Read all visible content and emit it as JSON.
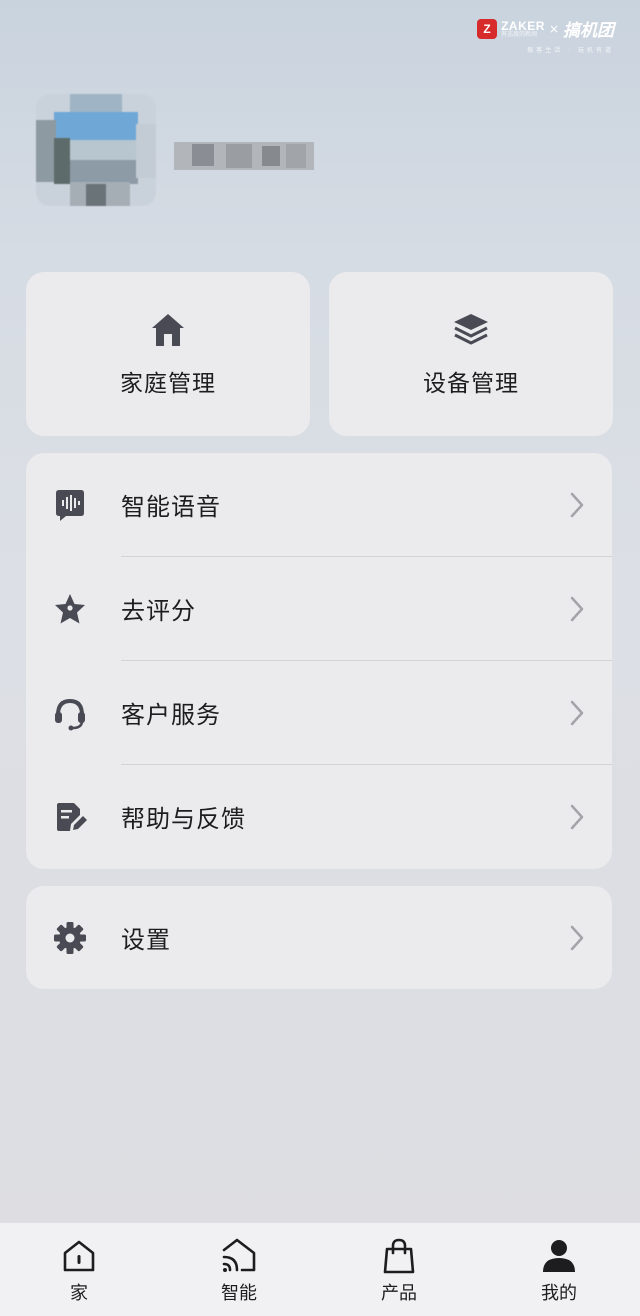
{
  "watermark": {
    "brand": "ZAKER",
    "brand_sub": "有态度的新闻",
    "times": "×",
    "partner": "搞机团",
    "tagline": "极客生活 · 玩机有道"
  },
  "profile": {
    "avatar": "avatar-image-blurred",
    "username": "",
    "username_blurred": true
  },
  "quick_actions": [
    {
      "label": "家庭管理",
      "icon": "home-icon"
    },
    {
      "label": "设备管理",
      "icon": "layers-icon"
    }
  ],
  "menu": [
    {
      "label": "智能语音",
      "icon": "voice-icon"
    },
    {
      "label": "去评分",
      "icon": "star-icon"
    },
    {
      "label": "客户服务",
      "icon": "headset-icon"
    },
    {
      "label": "帮助与反馈",
      "icon": "feedback-icon"
    }
  ],
  "settings": {
    "label": "设置",
    "icon": "gear-icon"
  },
  "tabbar": [
    {
      "label": "家",
      "icon": "home-outline-icon",
      "active": false
    },
    {
      "label": "智能",
      "icon": "smart-icon",
      "active": false
    },
    {
      "label": "产品",
      "icon": "shopping-bag-icon",
      "active": false
    },
    {
      "label": "我的",
      "icon": "person-icon",
      "active": true
    }
  ],
  "colors": {
    "card_bg": "#ebebed",
    "icon": "#4a4a55",
    "chevron": "#a3a3a8",
    "text": "#1d1d1f"
  }
}
